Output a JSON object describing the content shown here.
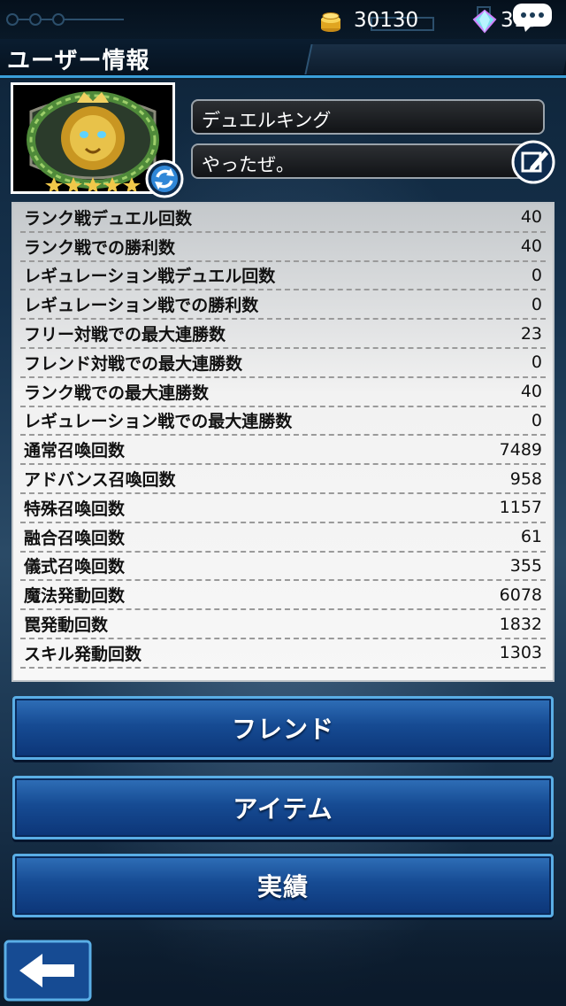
{
  "header": {
    "title": "ユーザー情報",
    "coins": "30130",
    "gems": "315"
  },
  "profile": {
    "name": "デュエルキング",
    "comment": "やったぜ。"
  },
  "stats": [
    {
      "label": "ランク戦デュエル回数",
      "value": "40"
    },
    {
      "label": "ランク戦での勝利数",
      "value": "40"
    },
    {
      "label": "レギュレーション戦デュエル回数",
      "value": "0"
    },
    {
      "label": "レギュレーション戦での勝利数",
      "value": "0"
    },
    {
      "label": "フリー対戦での最大連勝数",
      "value": "23"
    },
    {
      "label": "フレンド対戦での最大連勝数",
      "value": "0"
    },
    {
      "label": "ランク戦での最大連勝数",
      "value": "40"
    },
    {
      "label": "レギュレーション戦での最大連勝数",
      "value": "0"
    },
    {
      "label": "通常召喚回数",
      "value": "7489"
    },
    {
      "label": "アドバンス召喚回数",
      "value": "958"
    },
    {
      "label": "特殊召喚回数",
      "value": "1157"
    },
    {
      "label": "融合召喚回数",
      "value": "61"
    },
    {
      "label": "儀式召喚回数",
      "value": "355"
    },
    {
      "label": "魔法発動回数",
      "value": "6078"
    },
    {
      "label": "罠発動回数",
      "value": "1832"
    },
    {
      "label": "スキル発動回数",
      "value": "1303"
    }
  ],
  "menu": {
    "friend_label": "フレンド",
    "item_label": "アイテム",
    "achievement_label": "実績"
  },
  "icons": {
    "coin": "coin-icon",
    "gem": "gem-icon",
    "chat": "chat-icon",
    "refresh": "refresh-icon",
    "edit": "edit-icon",
    "back": "back-arrow-icon",
    "avatar": "gold-lion-emblem"
  },
  "colors": {
    "accent": "#3a9fd8",
    "button": "#164b93",
    "panel": "#f2f2f2"
  }
}
